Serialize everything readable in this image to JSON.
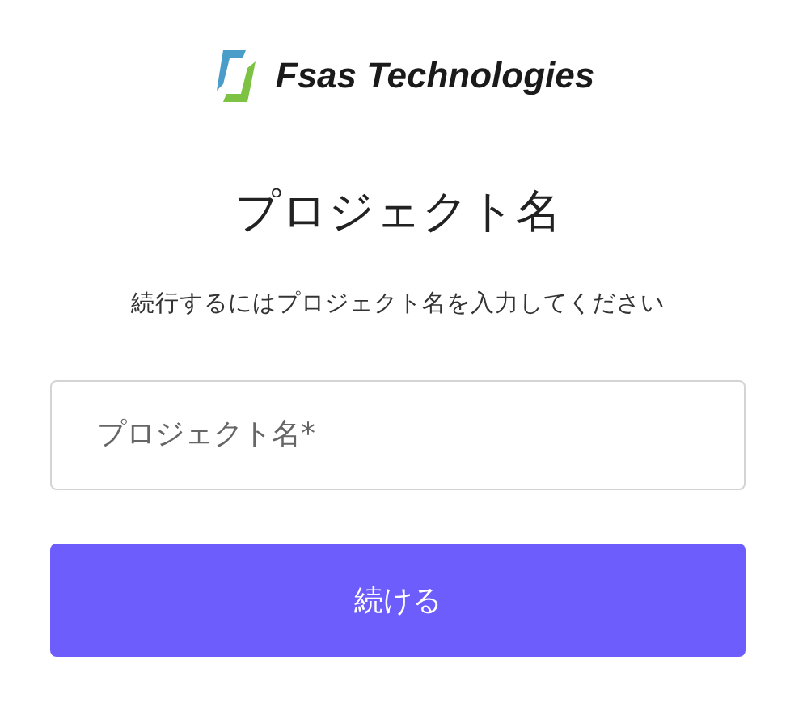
{
  "logo": {
    "text": "Fsas Technologies"
  },
  "title": "プロジェクト名",
  "subtitle": "続行するにはプロジェクト名を入力してください",
  "field": {
    "placeholder": "プロジェクト名*"
  },
  "button": {
    "label": "続ける"
  }
}
